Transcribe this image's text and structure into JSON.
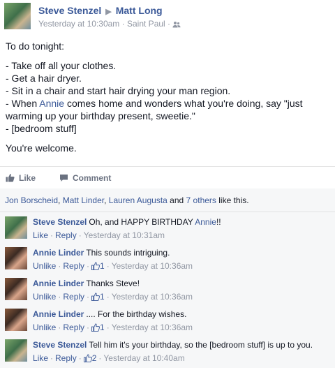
{
  "post": {
    "author": "Steve Stenzel",
    "recipient": "Matt Long",
    "timestamp": "Yesterday at 10:30am",
    "location": "Saint Paul",
    "intro": "To do tonight:",
    "lines": [
      "- Take off all your clothes.",
      "- Get a hair dryer.",
      "- Sit in a chair and start hair drying your man region.",
      "- When ",
      "Annie",
      " comes home and wonders what you're doing, say \"just warming up your birthday present, sweetie.\"",
      "- [bedroom stuff]"
    ],
    "outro": "You're welcome."
  },
  "actions": {
    "like": "Like",
    "comment": "Comment"
  },
  "likes": {
    "names": [
      "Jon Borscheid",
      "Matt Linder",
      "Lauren Augusta"
    ],
    "sep1": ", ",
    "sep2": ", ",
    "and": " and ",
    "others": "7 others",
    "suffix": " like this."
  },
  "comments": [
    {
      "author": "Steve Stenzel",
      "text_before": "Oh, and HAPPY BIRTHDAY ",
      "mention": "Annie",
      "text_after": "!!",
      "action": "Like",
      "reply": "Reply",
      "likes": "",
      "time": "Yesterday at 10:31am"
    },
    {
      "author": "Annie Linder",
      "text_before": "This sounds intriguing.",
      "mention": "",
      "text_after": "",
      "action": "Unlike",
      "reply": "Reply",
      "likes": "1",
      "time": "Yesterday at 10:36am"
    },
    {
      "author": "Annie Linder",
      "text_before": "Thanks Steve!",
      "mention": "",
      "text_after": "",
      "action": "Unlike",
      "reply": "Reply",
      "likes": "1",
      "time": "Yesterday at 10:36am"
    },
    {
      "author": "Annie Linder",
      "text_before": ".... For the birthday wishes.",
      "mention": "",
      "text_after": "",
      "action": "Unlike",
      "reply": "Reply",
      "likes": "1",
      "time": "Yesterday at 10:36am"
    },
    {
      "author": "Steve Stenzel",
      "text_before": "Tell him it's your birthday, so the [bedroom stuff] is up to you.",
      "mention": "",
      "text_after": "",
      "action": "Like",
      "reply": "Reply",
      "likes": "2",
      "time": "Yesterday at 10:40am"
    }
  ],
  "colors": {
    "link": "#3b5998",
    "meta": "#9197a3",
    "ufi_bg": "#f6f7f8"
  },
  "icons": {
    "separator": "triangle-right-icon",
    "audience": "friends-icon",
    "like": "thumbs-up-icon",
    "comment": "speech-bubble-icon"
  }
}
